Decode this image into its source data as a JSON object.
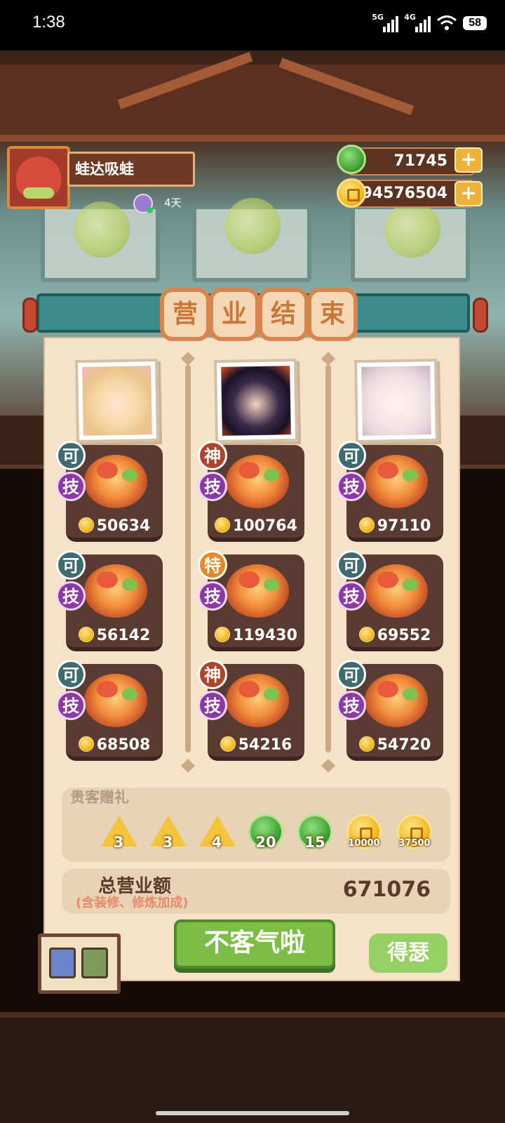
{
  "status_bar": {
    "time": "1:38",
    "net1": "5G",
    "net2": "4G",
    "battery": "58"
  },
  "player": {
    "name": "蛙达吸蛙",
    "days": "4天"
  },
  "resources": {
    "jade": "71745",
    "coins": "94576504"
  },
  "title_chars": [
    "营",
    "业",
    "结",
    "束"
  ],
  "dishes": [
    {
      "rank": "可",
      "rank_type": "ke",
      "skill": "技",
      "price": "50634"
    },
    {
      "rank": "神",
      "rank_type": "shen",
      "skill": "技",
      "price": "100764"
    },
    {
      "rank": "可",
      "rank_type": "ke",
      "skill": "技",
      "price": "97110"
    },
    {
      "rank": "可",
      "rank_type": "ke",
      "skill": "技",
      "price": "56142"
    },
    {
      "rank": "特",
      "rank_type": "te",
      "skill": "技",
      "price": "119430"
    },
    {
      "rank": "可",
      "rank_type": "ke",
      "skill": "技",
      "price": "69552"
    },
    {
      "rank": "可",
      "rank_type": "ke",
      "skill": "技",
      "price": "68508"
    },
    {
      "rank": "神",
      "rank_type": "shen",
      "skill": "技",
      "price": "54216"
    },
    {
      "rank": "可",
      "rank_type": "ke",
      "skill": "技",
      "price": "54720"
    }
  ],
  "gifts": {
    "title": "贵客赠礼",
    "items": [
      {
        "type": "seasoning",
        "count": "3"
      },
      {
        "type": "seasoning",
        "count": "3"
      },
      {
        "type": "seasoning",
        "count": "4"
      },
      {
        "type": "jade",
        "count": "20"
      },
      {
        "type": "jade",
        "count": "15"
      },
      {
        "type": "coin",
        "count": "10000"
      },
      {
        "type": "coin",
        "count": "37500"
      }
    ]
  },
  "total": {
    "label": "总营业额",
    "sublabel": "(含装修、修炼加成)",
    "value": "671076"
  },
  "buttons": {
    "main": "不客气啦",
    "side": "得瑟"
  },
  "colors": {
    "accent_green": "#7cbd46",
    "panel_bg": "#f6e2c8",
    "card_bg": "#5a3b31",
    "skill_purple": "#8b3aa3"
  }
}
